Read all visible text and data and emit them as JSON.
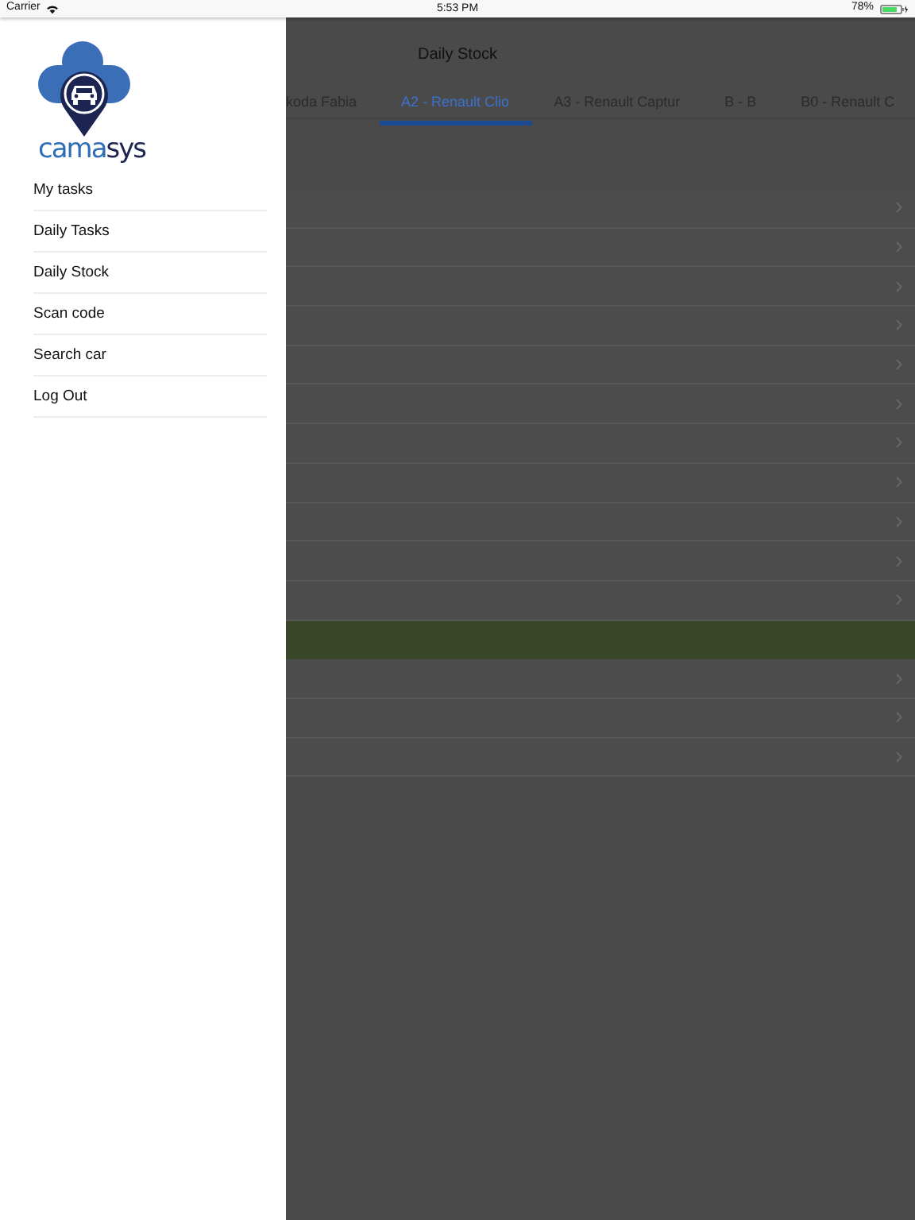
{
  "status_bar": {
    "carrier": "Carrier",
    "time": "5:53 PM",
    "battery": "78%"
  },
  "drawer": {
    "logo": {
      "parts": [
        {
          "text": "cama",
          "color": "#2f6db5"
        },
        {
          "text": "sys",
          "color": "#1c2452"
        }
      ]
    },
    "items": [
      {
        "label": "My tasks"
      },
      {
        "label": "Daily Tasks"
      },
      {
        "label": "Daily Stock"
      },
      {
        "label": "Scan code"
      },
      {
        "label": "Search car"
      },
      {
        "label": "Log Out"
      }
    ]
  },
  "nav": {
    "title": "Daily Stock"
  },
  "tabs": [
    {
      "label": "koda Fabia",
      "selected": false
    },
    {
      "label": "A2 - Renault Clio",
      "selected": true
    },
    {
      "label": "A3 - Renault Captur",
      "selected": false
    },
    {
      "label": "B - B",
      "selected": false
    },
    {
      "label": "B0 - Renault C",
      "selected": false
    }
  ],
  "rows": [
    {
      "kind": "link"
    },
    {
      "kind": "link"
    },
    {
      "kind": "link"
    },
    {
      "kind": "link"
    },
    {
      "kind": "link"
    },
    {
      "kind": "link"
    },
    {
      "kind": "link"
    },
    {
      "kind": "link"
    },
    {
      "kind": "link"
    },
    {
      "kind": "link"
    },
    {
      "kind": "link"
    },
    {
      "kind": "highlight"
    },
    {
      "kind": "link"
    },
    {
      "kind": "link"
    },
    {
      "kind": "link"
    }
  ]
}
